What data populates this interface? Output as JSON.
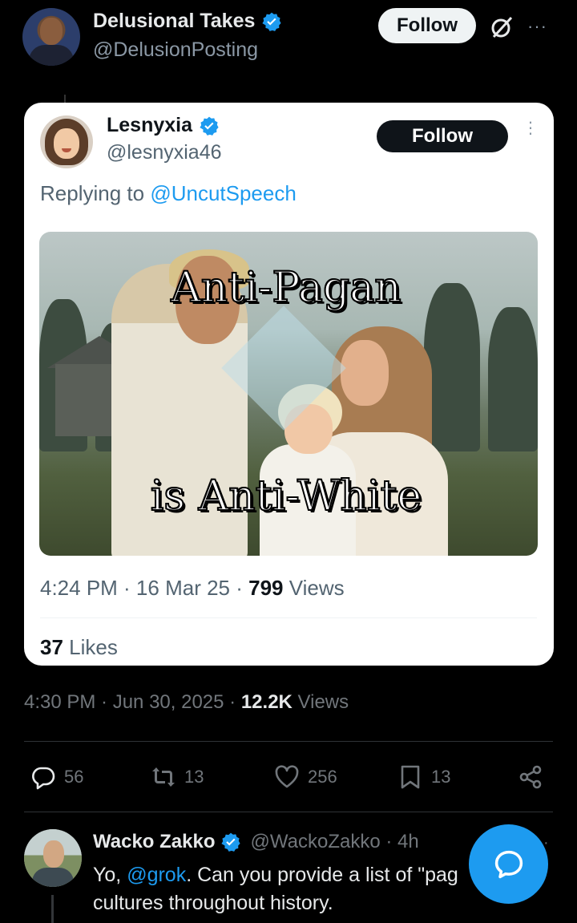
{
  "main_tweet": {
    "display_name": "Delusional Takes",
    "handle": "@DelusionPosting",
    "follow_label": "Follow",
    "more": "···",
    "timestamp": "4:30 PM · Jun 30, 2025 · ",
    "views_count": "12.2K",
    "views_label": " Views"
  },
  "quoted": {
    "display_name": "Lesnyxia",
    "handle": "@lesnyxia46",
    "follow_label": "Follow",
    "more": "⋮",
    "replying_prefix": "Replying to ",
    "replying_mention": "@UncutSpeech",
    "image_text_top": "Anti-Pagan",
    "image_text_bottom": "is Anti-White",
    "meta_prefix": "4:24 PM · 16 Mar 25 · ",
    "views_count": "799",
    "views_label": " Views",
    "likes_count": "37",
    "likes_label": " Likes"
  },
  "actions": {
    "replies": "56",
    "reposts": "13",
    "likes": "256",
    "bookmarks": "13"
  },
  "reply": {
    "display_name": "Wacko Zakko",
    "handle": "@WackoZakko · 4h",
    "more": "·",
    "text_prefix": "Yo, ",
    "mention": "@grok",
    "text_suffix": ". Can you provide a list of \"pag",
    "text_line2": "cultures throughout history."
  },
  "colors": {
    "accent": "#1d9bf0",
    "background": "#000000",
    "muted": "#71767b"
  },
  "icons": [
    "verified-badge-icon",
    "grok-icon",
    "reply-icon",
    "repost-icon",
    "like-icon",
    "bookmark-icon",
    "share-icon",
    "compose-icon"
  ]
}
